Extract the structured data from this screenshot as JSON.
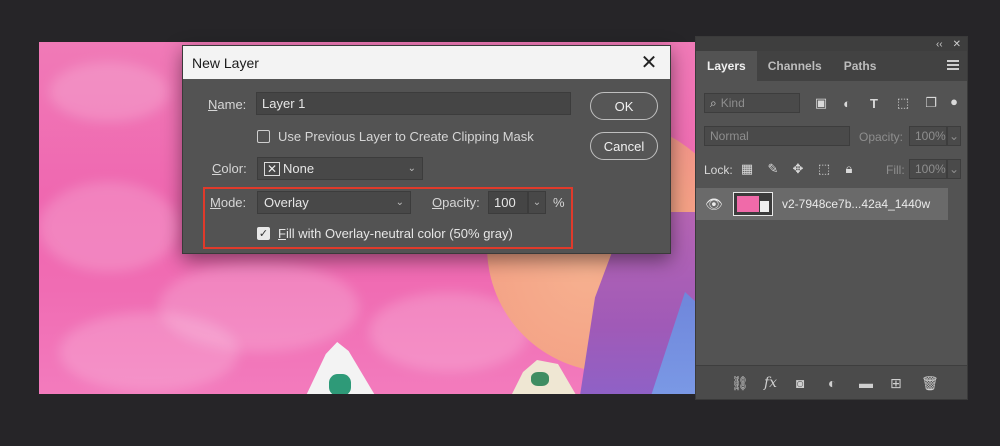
{
  "dialog": {
    "title": "New Layer",
    "name_label_prefix": "",
    "name_label_u": "N",
    "name_label_rest": "ame:",
    "name_value": "Layer 1",
    "clipping_label": "Use Previous Layer to Create Clipping Mask",
    "clipping_checked": false,
    "color_label_u": "C",
    "color_label_rest": "olor:",
    "color_value": "None",
    "mode_label_u": "M",
    "mode_label_rest": "ode:",
    "mode_value": "Overlay",
    "opacity_label_u": "O",
    "opacity_label_rest": "pacity:",
    "opacity_value": "100",
    "opacity_unit": "%",
    "fill_label_u": "F",
    "fill_label_rest": "ill with Overlay-neutral color (50% gray)",
    "fill_checked": true,
    "ok_label": "OK",
    "cancel_label": "Cancel"
  },
  "panel": {
    "tabs": [
      {
        "label": "Layers"
      },
      {
        "label": "Channels"
      },
      {
        "label": "Paths"
      }
    ],
    "collapse_glyph": "‹‹",
    "close_glyph": "✕",
    "kind_placeholder": "Kind",
    "blend_mode": "Normal",
    "opacity_label": "Opacity:",
    "opacity_value": "100%",
    "lock_label": "Lock:",
    "fill_label": "Fill:",
    "fill_value": "100%",
    "layer_name": "v2-7948ce7b...42a4_1440w"
  },
  "colors": {
    "accent_highlight": "#e03a2b",
    "canvas_pink": "#ef67b0",
    "panel_bg": "#535353"
  }
}
